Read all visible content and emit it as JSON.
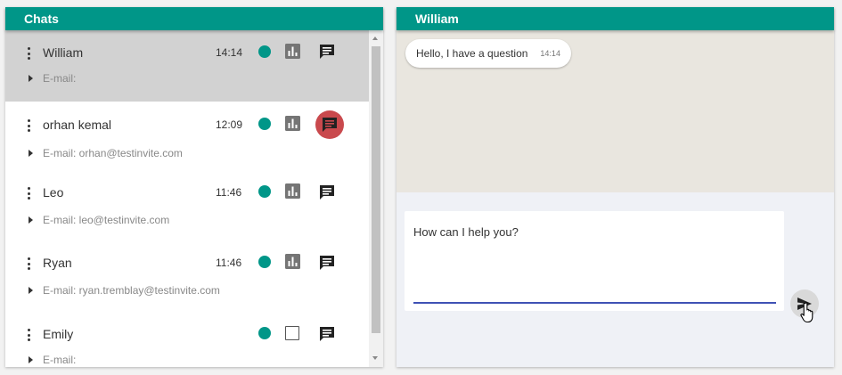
{
  "chats_panel": {
    "title": "Chats"
  },
  "conversation": {
    "title": "William",
    "messages": [
      {
        "text": "Hello, I have a question",
        "time": "14:14"
      }
    ],
    "compose_value": "How can I help you?"
  },
  "chats": [
    {
      "name": "William",
      "time": "14:14",
      "email": "E-mail:",
      "selected": true
    },
    {
      "name": "orhan kemal",
      "time": "12:09",
      "email": "E-mail: orhan@testinvite.com",
      "alert": true
    },
    {
      "name": "Leo",
      "time": "11:46",
      "email": "E-mail: leo@testinvite.com"
    },
    {
      "name": "Ryan",
      "time": "11:46",
      "email": "E-mail: ryan.tremblay@testinvite.com"
    },
    {
      "name": "Emily",
      "time": "",
      "email": "E-mail:"
    }
  ],
  "colors": {
    "header": "#009688",
    "status_online": "#009688",
    "alert_chat": "#c9494d",
    "selected_row": "#d2d2d2",
    "input_underline": "#3f51b5"
  },
  "icons": [
    "more-vert-icon",
    "caret-right-icon",
    "status-dot-icon",
    "bar-chart-icon",
    "chat-icon",
    "checkbox-icon",
    "send-icon",
    "hand-cursor-icon"
  ]
}
